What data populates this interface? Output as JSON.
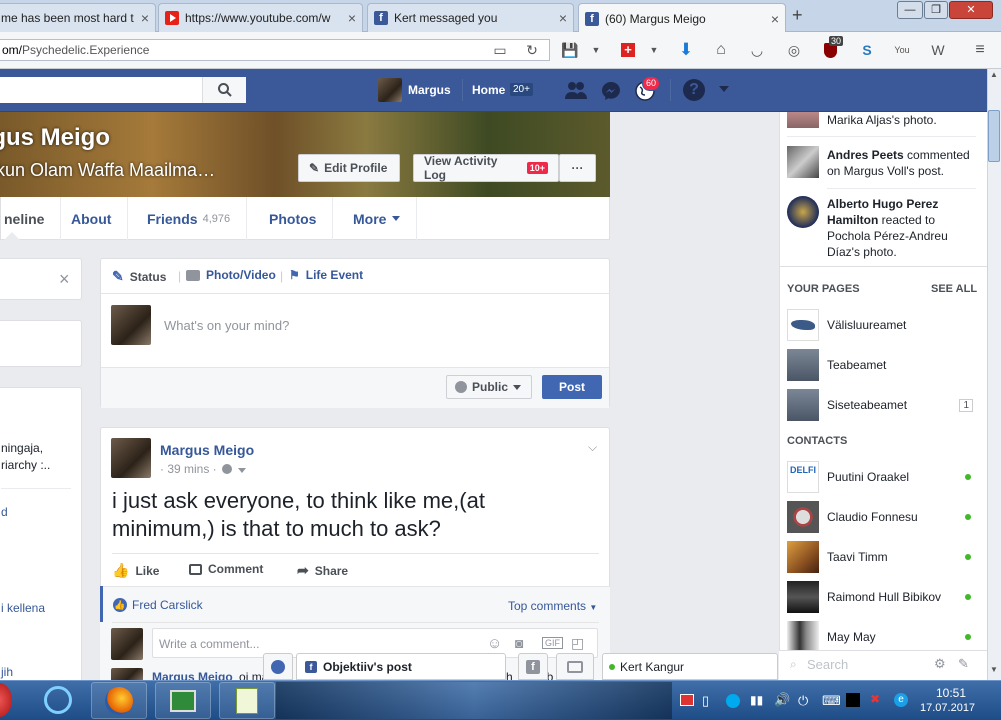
{
  "browser": {
    "tabs": [
      {
        "title": "me has been most hard t",
        "icon": "facebook-icon"
      },
      {
        "title": "https://www.youtube.com/w",
        "icon": "youtube-icon"
      },
      {
        "title": "Kert messaged you",
        "icon": "facebook-icon"
      },
      {
        "title": "(60) Margus Meigo",
        "icon": "facebook-icon",
        "active": true
      }
    ],
    "new_tab": "+",
    "url_prefix": "om/",
    "url_path": "Psychedelic.Experience",
    "badge_30": "30"
  },
  "fb_header": {
    "search_placeholder": "",
    "user_name": "Margus",
    "home_label": "Home",
    "home_count": "20+",
    "notif_count": "60"
  },
  "profile": {
    "name": "rgus Meigo",
    "alt_name": "kun Olam Waffa Maailma…",
    "edit_profile": "Edit Profile",
    "activity_log": "View Activity Log",
    "activity_count": "10+",
    "more_dots": "···",
    "tabs": {
      "timeline": "neline",
      "about": "About",
      "friends": "Friends",
      "friends_count": "4,976",
      "photos": "Photos",
      "more": "More"
    }
  },
  "left_col": {
    "close": "×",
    "snip1": "ningaja,",
    "snip2": "riarchy :..",
    "snip3": "d",
    "snip4": "i kellena",
    "snip5": "jih"
  },
  "composer": {
    "status": "Status",
    "photo_video": "Photo/Video",
    "life_event": "Life Event",
    "placeholder": "What's on your mind?",
    "privacy": "Public",
    "post": "Post"
  },
  "post": {
    "author": "Margus Meigo",
    "time": "· 39 mins ·",
    "text": "i just ask everyone, to think like me,(at minimum,) is that to much to ask?",
    "like": "Like",
    "comment": "Comment",
    "share": "Share",
    "liker": "Fred Carslick",
    "top_comments": "Top comments",
    "write_comment": "Write a comment...",
    "next_author": "Margus Meigo",
    "next_snip": "oi ma",
    "tail1": "h",
    "tail2": "eb"
  },
  "chat_tabs": {
    "objektiiv": "Objektiiv's post",
    "kert": "Kert Kangur"
  },
  "ticker": [
    {
      "text": "Marika Aljas's photo."
    },
    {
      "bold": "Andres Peets",
      "text": " commented on Margus Voll's post."
    },
    {
      "bold": "Alberto Hugo Perez Hamilton",
      "text": " reacted to Pochola Pérez-Andreu Díaz's photo."
    }
  ],
  "your_pages": {
    "heading": "YOUR PAGES",
    "see_all": "SEE ALL",
    "items": [
      {
        "name": "Välisluureamet"
      },
      {
        "name": "Teabeamet"
      },
      {
        "name": "Siseteabeamet",
        "badge": "1"
      }
    ]
  },
  "contacts": {
    "heading": "CONTACTS",
    "items": [
      {
        "name": "Puutini Oraakel",
        "pic": "DELFI"
      },
      {
        "name": "Claudio Fonnesu"
      },
      {
        "name": "Taavi Timm"
      },
      {
        "name": "Raimond Hull Bibikov"
      },
      {
        "name": "May May"
      }
    ],
    "search_placeholder": "Search"
  },
  "taskbar": {
    "time": "10:51",
    "date": "17.07.2017"
  },
  "colors": {
    "fb_blue": "#3b5998",
    "link": "#365899",
    "badge_red": "#f02849",
    "online": "#42b72a"
  }
}
